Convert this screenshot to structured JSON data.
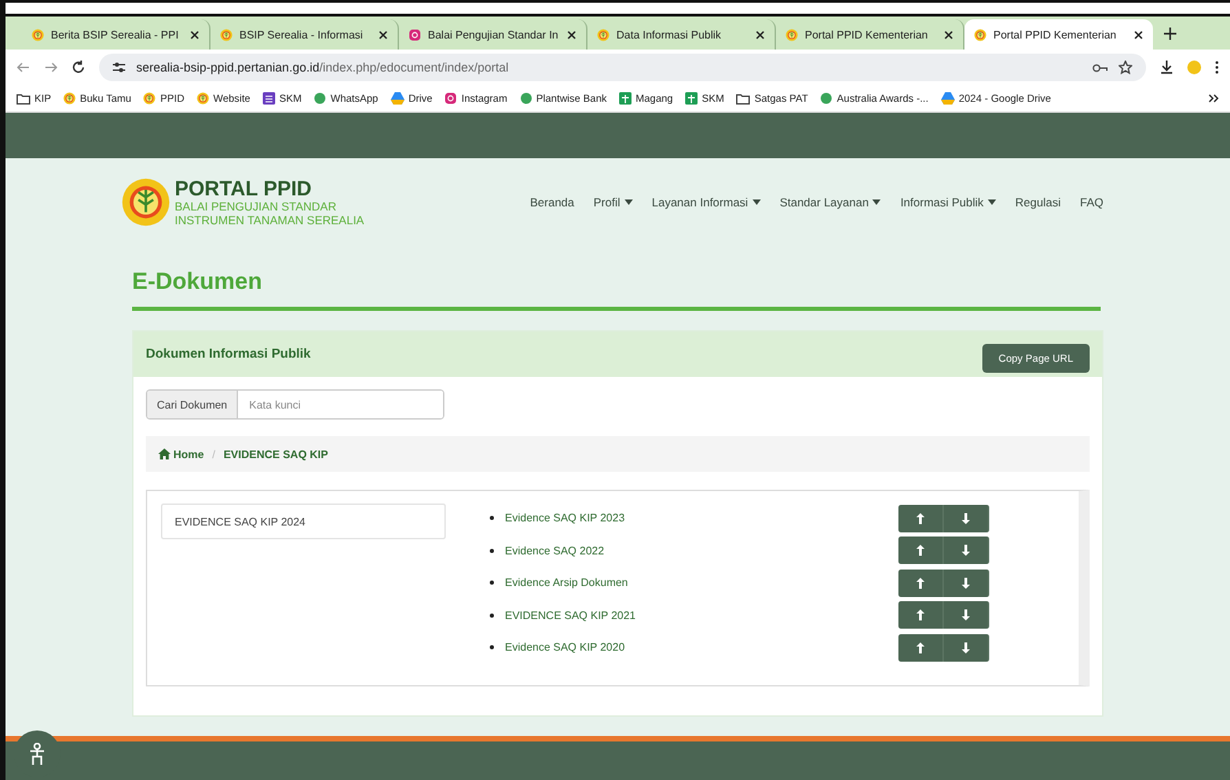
{
  "browser": {
    "tabs": [
      {
        "title": "Berita BSIP Serealia - PPI",
        "selected": false,
        "kind": "logo"
      },
      {
        "title": "BSIP Serealia - Informasi",
        "selected": false,
        "kind": "logo"
      },
      {
        "title": "Balai Pengujian Standar In",
        "selected": false,
        "kind": "instagram"
      },
      {
        "title": "Data Informasi Publik",
        "selected": false,
        "kind": "logo"
      },
      {
        "title": "Portal PPID Kementerian",
        "selected": false,
        "kind": "logo"
      },
      {
        "title": "Portal PPID Kementerian",
        "selected": true,
        "kind": "logo"
      }
    ],
    "url_host": "serealia-bsip-ppid.pertanian.go.id",
    "url_path": "/index.php/edocument/index/portal",
    "bookmarks": [
      {
        "label": "KIP",
        "kind": "folder"
      },
      {
        "label": "Buku Tamu",
        "kind": "logo"
      },
      {
        "label": "PPID",
        "kind": "logo"
      },
      {
        "label": "Website",
        "kind": "logo"
      },
      {
        "label": "SKM",
        "kind": "form"
      },
      {
        "label": "WhatsApp",
        "kind": "dot"
      },
      {
        "label": "Drive",
        "kind": "drive"
      },
      {
        "label": "Instagram",
        "kind": "instagram"
      },
      {
        "label": "Plantwise Bank",
        "kind": "dot"
      },
      {
        "label": "Magang",
        "kind": "sheet"
      },
      {
        "label": "SKM",
        "kind": "sheet"
      },
      {
        "label": "Satgas PAT",
        "kind": "folder"
      },
      {
        "label": "Australia Awards -...",
        "kind": "dot"
      },
      {
        "label": "2024 - Google Drive",
        "kind": "drive"
      }
    ]
  },
  "site": {
    "title": "PORTAL PPID",
    "subtitle_1": "BALAI PENGUJIAN STANDAR",
    "subtitle_2": "INSTRUMEN TANAMAN SEREALIA",
    "nav": [
      {
        "label": "Beranda",
        "dropdown": false
      },
      {
        "label": "Profil",
        "dropdown": true
      },
      {
        "label": "Layanan Informasi",
        "dropdown": true
      },
      {
        "label": "Standar Layanan",
        "dropdown": true
      },
      {
        "label": "Informasi Publik",
        "dropdown": true
      },
      {
        "label": "Regulasi",
        "dropdown": false
      },
      {
        "label": "FAQ",
        "dropdown": false
      }
    ]
  },
  "page_title": "E-Dokumen",
  "card": {
    "title": "Dokumen Informasi Publik",
    "copy_button": "Copy Page URL",
    "search": {
      "label": "Cari Dokumen",
      "placeholder": "Kata kunci"
    },
    "breadcrumb": [
      "Home",
      "EVIDENCE SAQ KIP"
    ],
    "breadcrumb_separator": "/",
    "folder": "EVIDENCE SAQ KIP 2024",
    "documents": [
      "Evidence SAQ KIP 2023",
      "Evidence SAQ 2022",
      "Evidence Arsip Dokumen",
      "EVIDENCE SAQ KIP 2021",
      "Evidence SAQ KIP 2020"
    ]
  }
}
